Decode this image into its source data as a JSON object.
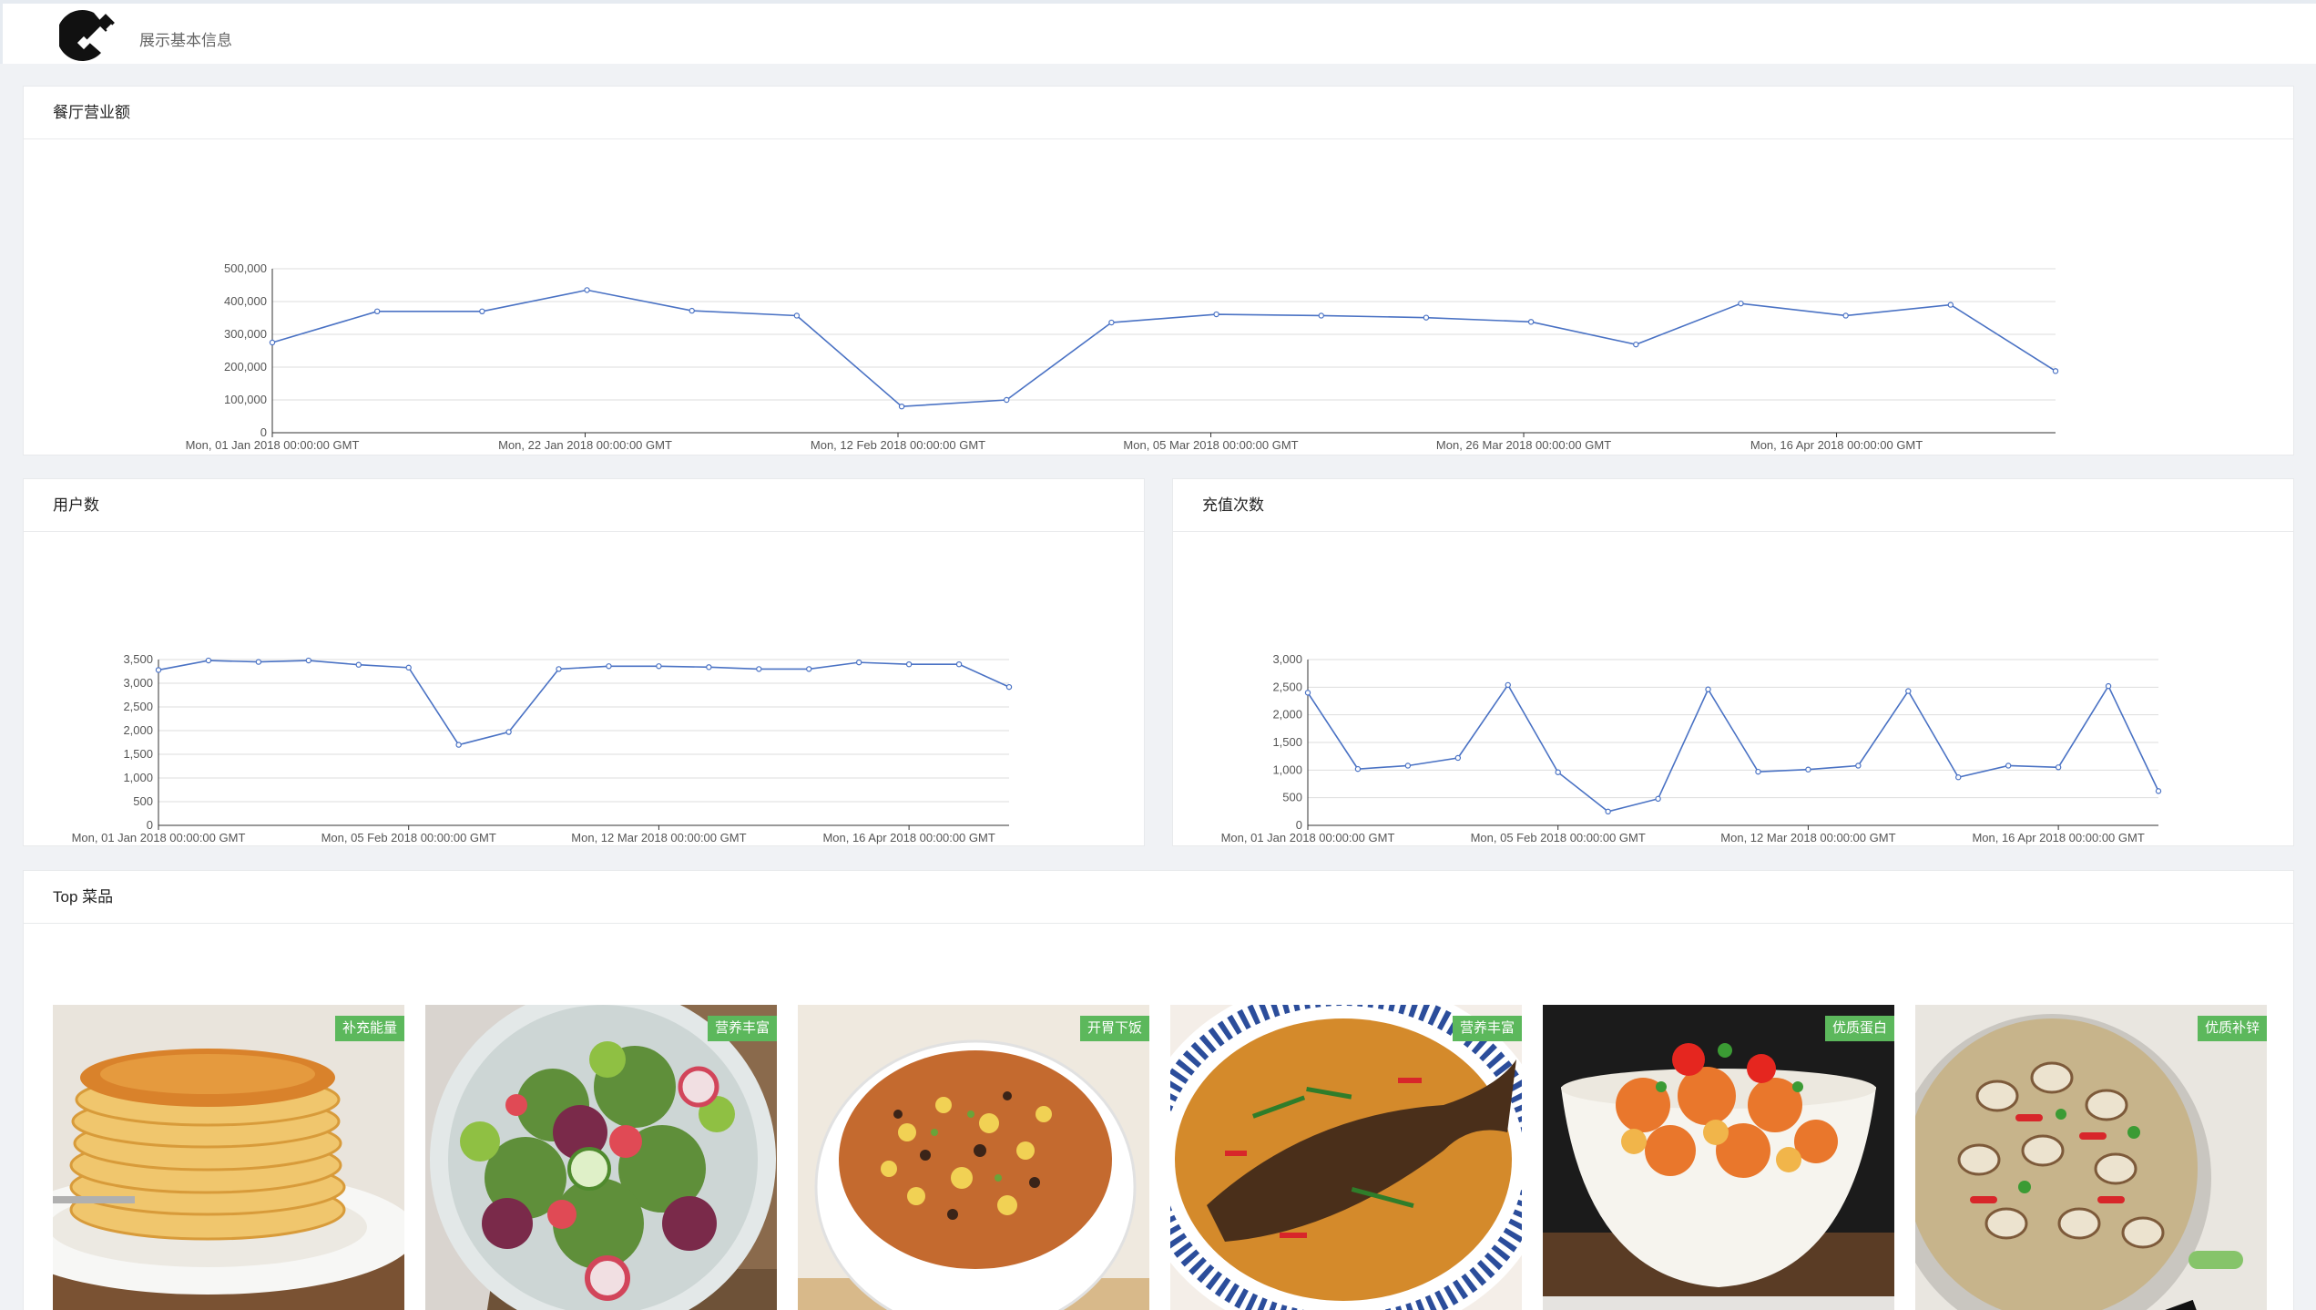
{
  "header": {
    "subtitle": "展示基本信息"
  },
  "cards": {
    "revenue": {
      "title": "餐厅营业额"
    },
    "users": {
      "title": "用户数"
    },
    "recharge": {
      "title": "充值次数"
    },
    "top_dishes": {
      "title": "Top 菜品"
    }
  },
  "chart_data": [
    {
      "type": "line",
      "title": "",
      "ylim": [
        0,
        500000
      ],
      "yticks": [
        "0",
        "100,000",
        "200,000",
        "300,000",
        "400,000",
        "500,000"
      ],
      "xticks": [
        "Mon, 01 Jan 2018 00:00:00 GMT",
        "Mon, 22 Jan 2018 00:00:00 GMT",
        "Mon, 12 Feb 2018 00:00:00 GMT",
        "Mon, 05 Mar 2018 00:00:00 GMT",
        "Mon, 26 Mar 2018 00:00:00 GMT",
        "Mon, 16 Apr 2018 00:00:00 GMT"
      ],
      "values": [
        275000,
        370000,
        370000,
        435000,
        372000,
        357000,
        80000,
        100000,
        336000,
        361000,
        357000,
        351000,
        338000,
        269000,
        394000,
        357000,
        390000,
        188000
      ],
      "color": "#4a72c4",
      "grid": true
    },
    {
      "type": "line",
      "title": "",
      "ylim": [
        0,
        3500
      ],
      "yticks": [
        "0",
        "500",
        "1,000",
        "1,500",
        "2,000",
        "2,500",
        "3,000",
        "3,500"
      ],
      "xticks": [
        "Mon, 01 Jan 2018 00:00:00 GMT",
        "Mon, 05 Feb 2018 00:00:00 GMT",
        "Mon, 12 Mar 2018 00:00:00 GMT",
        "Mon, 16 Apr 2018 00:00:00 GMT"
      ],
      "values": [
        3280,
        3480,
        3450,
        3480,
        3390,
        3330,
        1700,
        1970,
        3300,
        3360,
        3360,
        3340,
        3300,
        3300,
        3440,
        3400,
        3400,
        2920
      ],
      "color": "#4a72c4",
      "grid": true
    },
    {
      "type": "line",
      "title": "",
      "ylim": [
        0,
        3000
      ],
      "yticks": [
        "0",
        "500",
        "1,000",
        "1,500",
        "2,000",
        "2,500",
        "3,000"
      ],
      "xticks": [
        "Mon, 01 Jan 2018 00:00:00 GMT",
        "Mon, 05 Feb 2018 00:00:00 GMT",
        "Mon, 12 Mar 2018 00:00:00 GMT",
        "Mon, 16 Apr 2018 00:00:00 GMT"
      ],
      "values": [
        2400,
        1020,
        1080,
        1220,
        2540,
        960,
        250,
        480,
        2460,
        970,
        1010,
        1080,
        2430,
        870,
        1080,
        1050,
        2520,
        620
      ],
      "color": "#4a72c4",
      "grid": true
    }
  ],
  "dishes": [
    {
      "tag": "补充能量",
      "icon": "pancake-stack-image"
    },
    {
      "tag": "营养丰富",
      "icon": "salad-bowl-image"
    },
    {
      "tag": "开胃下饭",
      "icon": "fried-rice-bowl-image"
    },
    {
      "tag": "营养丰富",
      "icon": "braised-fish-image"
    },
    {
      "tag": "优质蛋白",
      "icon": "shrimp-dish-image"
    },
    {
      "tag": "优质补锌",
      "icon": "clam-pot-image"
    }
  ],
  "colors": {
    "accent": "#4a72c4",
    "tag_green": "#5cb85c",
    "page_bg": "#f0f2f5"
  }
}
